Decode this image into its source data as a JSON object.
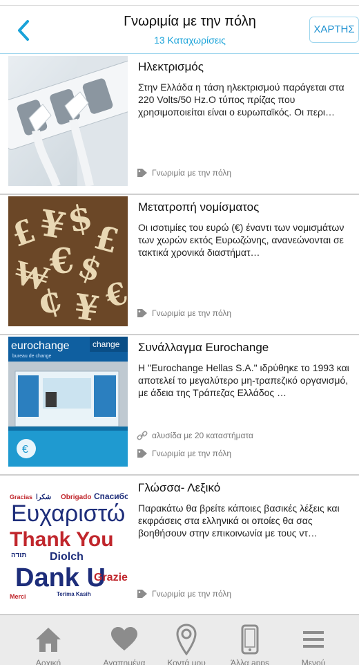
{
  "header": {
    "title": "Γνωριμία με την πόλη",
    "subtitle": "13 Καταχωρίσεις",
    "map_button": "ΧΑΡΤΗΣ"
  },
  "items": [
    {
      "title": "Ηλεκτρισμός",
      "description": "Στην Ελλάδα η τάση ηλεκτρισμού παράγεται στα 220 Volts/50 Hz.Ο τύπος πρίζας που χρησιμοποιείται είναι ο ευρωπαϊκός. Οι περι…",
      "category": "Γνωριμία με την πόλη",
      "image": "electric-plugs"
    },
    {
      "title": "Μετατροπή νομίσματος",
      "description": "Οι ισοτιμίες του ευρώ (€) έναντι των νομισμάτων των χωρών εκτός Ευρωζώνης, ανανεώνονται σε τακτικά χρονικά διαστήματ…",
      "category": "Γνωριμία με την πόλη",
      "image": "currency-symbols"
    },
    {
      "title": "Συνάλλαγμα Eurochange",
      "description": "Η \"Eurochange Hellas S.A.\" ιδρύθηκε το 1993 και αποτελεί το μεγαλύτερο μη-τραπεζικό οργανισμό, με άδεια της Τράπεζας Ελλάδος …",
      "link_text": "αλυσίδα με 20 καταστήματα",
      "category": "Γνωριμία με την πόλη",
      "image": "eurochange-store",
      "image_text": {
        "brand": "eurochange",
        "sub": "bureau de change",
        "side": "change"
      }
    },
    {
      "title": "Γλώσσα- Λεξικό",
      "description": "Παρακάτω θα βρείτε κάποιες βασικές λέξεις και εκφράσεις στα ελληνικά οι οποίες θα σας βοηθήσουν στην επικοινωνία με τους ντ…",
      "category": "Γνωριμία με την πόλη",
      "image": "thank-you-word-cloud",
      "image_text": {
        "w1": "Gracias",
        "w2": "Obrigado",
        "w3": "Спасибо",
        "w4": "Ευχαριστώ",
        "w5": "Thank You",
        "w6": "Dank U",
        "w7": "Diolch",
        "w8": "Grazie",
        "w9": "Merci",
        "w10": "תודה",
        "w11": "شكرا",
        "w12": "Terima Kasih"
      }
    }
  ],
  "tabbar": [
    {
      "label": "Αρχική",
      "icon": "home-icon"
    },
    {
      "label": "Αγαπημένα",
      "icon": "heart-icon"
    },
    {
      "label": "Κοντά μου",
      "icon": "map-pin-icon"
    },
    {
      "label": "Άλλα apps",
      "icon": "phone-icon"
    },
    {
      "label": "Μενού",
      "icon": "menu-icon"
    }
  ],
  "colors": {
    "accent": "#1aa3d9",
    "tab_icon": "#8c8c8c",
    "tab_bar": "#ebebeb"
  }
}
